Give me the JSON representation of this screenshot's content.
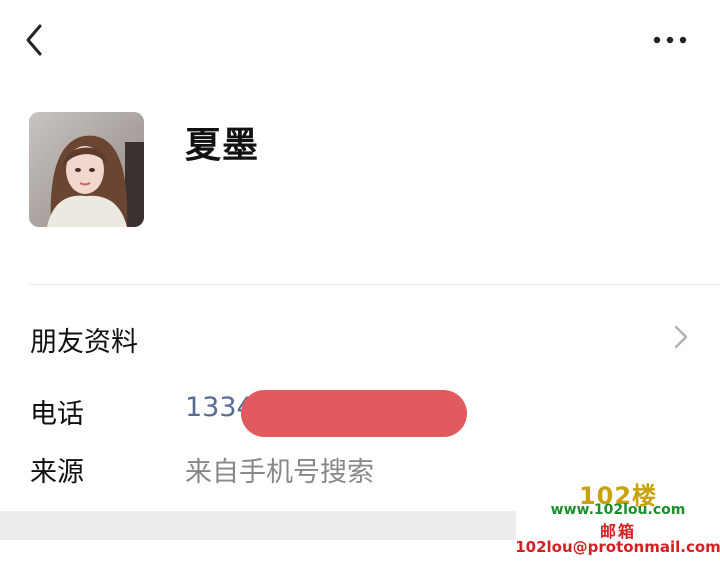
{
  "header": {
    "back_icon": "chevron-left-icon",
    "more_icon": "more-horizontal-icon"
  },
  "profile": {
    "avatar": "profile-photo",
    "name": "夏墨"
  },
  "menu": {
    "friend_info_label": "朋友资料",
    "chevron_icon": "chevron-right-icon"
  },
  "details": {
    "phone_label": "电话",
    "phone_value": "1334",
    "phone_redacted": true,
    "source_label": "来源",
    "source_value": "来自手机号搜索"
  },
  "watermark": {
    "brand": "102楼",
    "url": "www.102lou.com",
    "mail_label": "邮箱",
    "email": "102lou@protonmail.com"
  },
  "colors": {
    "link_blue": "#576b95",
    "redaction": "#e05a5f",
    "secondary_text": "#888888",
    "divider": "#e6e6e6",
    "brand_gold": "#c9a20a",
    "brand_green": "#1c8e2a",
    "brand_red": "#d42020"
  }
}
